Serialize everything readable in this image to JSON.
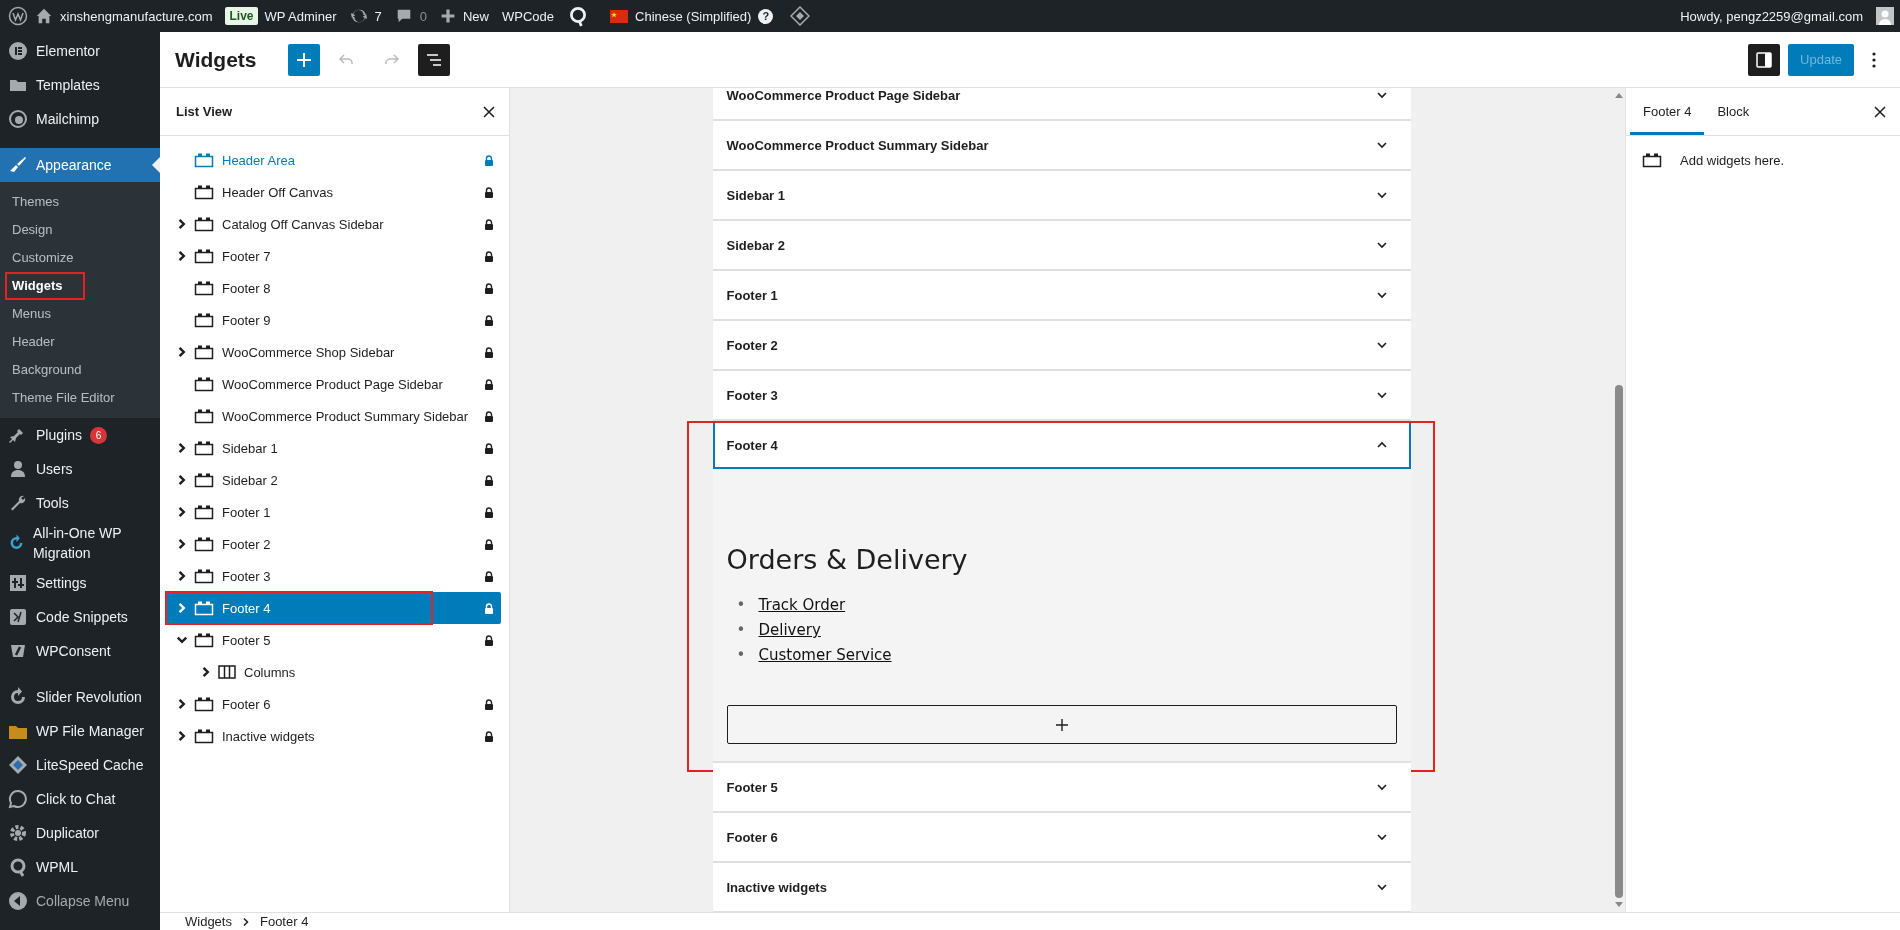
{
  "admin_bar": {
    "site_name": "xinshengmanufacture.com",
    "environment_badge": "Live",
    "tools": "WP Adminer",
    "updates": "7",
    "comments": "0",
    "new": "New",
    "wpcode": "WPCode",
    "language": "Chinese (Simplified)",
    "language_help": "?",
    "greeting": "Howdy, pengz2259@gmail.com"
  },
  "admin_menu": {
    "items": [
      {
        "kind": "item",
        "label": "Elementor",
        "selected": false
      },
      {
        "kind": "item",
        "label": "Templates",
        "selected": false
      },
      {
        "kind": "item",
        "label": "Mailchimp",
        "selected": false
      },
      {
        "kind": "separator"
      },
      {
        "kind": "item",
        "label": "Appearance",
        "selected": true,
        "children": [
          {
            "label": "Themes",
            "selected": false,
            "marked": false
          },
          {
            "label": "Design",
            "selected": false,
            "marked": false
          },
          {
            "label": "Customize",
            "selected": false,
            "marked": false
          },
          {
            "label": "Widgets",
            "selected": true,
            "marked": true
          },
          {
            "label": "Menus",
            "selected": false,
            "marked": false
          },
          {
            "label": "Header",
            "selected": false,
            "marked": false
          },
          {
            "label": "Background",
            "selected": false,
            "marked": false
          },
          {
            "label": "Theme File Editor",
            "selected": false,
            "marked": false
          }
        ]
      },
      {
        "kind": "item",
        "label": "Plugins",
        "selected": false,
        "badge": "6"
      },
      {
        "kind": "item",
        "label": "Users",
        "selected": false
      },
      {
        "kind": "item",
        "label": "Tools",
        "selected": false
      },
      {
        "kind": "item",
        "label": "All-in-One WP Migration",
        "selected": false
      },
      {
        "kind": "item",
        "label": "Settings",
        "selected": false
      },
      {
        "kind": "item",
        "label": "Code Snippets",
        "selected": false
      },
      {
        "kind": "item",
        "label": "WPConsent",
        "selected": false
      },
      {
        "kind": "separator"
      },
      {
        "kind": "item",
        "label": "Slider Revolution",
        "selected": false
      },
      {
        "kind": "item",
        "label": "WP File Manager",
        "selected": false
      },
      {
        "kind": "item",
        "label": "LiteSpeed Cache",
        "selected": false
      },
      {
        "kind": "item",
        "label": "Click to Chat",
        "selected": false
      },
      {
        "kind": "item",
        "label": "Duplicator",
        "selected": false
      },
      {
        "kind": "item",
        "label": "WPML",
        "selected": false
      }
    ],
    "collapse": "Collapse Menu"
  },
  "editor": {
    "title": "Widgets",
    "update_button": {
      "label": "Update",
      "disabled": true
    }
  },
  "list_view": {
    "title": "List View",
    "items": [
      {
        "label": "Header Area",
        "kind": "widget-area",
        "hovered": true,
        "selected": false,
        "expandable": false,
        "expanded": false,
        "locked": true,
        "marked": false
      },
      {
        "label": "Header Off Canvas",
        "kind": "widget-area",
        "hovered": false,
        "selected": false,
        "expandable": false,
        "expanded": false,
        "locked": true,
        "marked": false
      },
      {
        "label": "Catalog Off Canvas Sidebar",
        "kind": "widget-area",
        "hovered": false,
        "selected": false,
        "expandable": true,
        "expanded": false,
        "locked": true,
        "marked": false
      },
      {
        "label": "Footer 7",
        "kind": "widget-area",
        "hovered": false,
        "selected": false,
        "expandable": true,
        "expanded": false,
        "locked": true,
        "marked": false
      },
      {
        "label": "Footer 8",
        "kind": "widget-area",
        "hovered": false,
        "selected": false,
        "expandable": false,
        "expanded": false,
        "locked": true,
        "marked": false
      },
      {
        "label": "Footer 9",
        "kind": "widget-area",
        "hovered": false,
        "selected": false,
        "expandable": false,
        "expanded": false,
        "locked": true,
        "marked": false
      },
      {
        "label": "WooCommerce Shop Sidebar",
        "kind": "widget-area",
        "hovered": false,
        "selected": false,
        "expandable": true,
        "expanded": false,
        "locked": true,
        "marked": false
      },
      {
        "label": "WooCommerce Product Page Sidebar",
        "kind": "widget-area",
        "hovered": false,
        "selected": false,
        "expandable": false,
        "expanded": false,
        "locked": true,
        "marked": false
      },
      {
        "label": "WooCommerce Product Summary Sidebar",
        "kind": "widget-area",
        "hovered": false,
        "selected": false,
        "expandable": false,
        "expanded": false,
        "locked": true,
        "marked": false
      },
      {
        "label": "Sidebar 1",
        "kind": "widget-area",
        "hovered": false,
        "selected": false,
        "expandable": true,
        "expanded": false,
        "locked": true,
        "marked": false
      },
      {
        "label": "Sidebar 2",
        "kind": "widget-area",
        "hovered": false,
        "selected": false,
        "expandable": true,
        "expanded": false,
        "locked": true,
        "marked": false
      },
      {
        "label": "Footer 1",
        "kind": "widget-area",
        "hovered": false,
        "selected": false,
        "expandable": true,
        "expanded": false,
        "locked": true,
        "marked": false
      },
      {
        "label": "Footer 2",
        "kind": "widget-area",
        "hovered": false,
        "selected": false,
        "expandable": true,
        "expanded": false,
        "locked": true,
        "marked": false
      },
      {
        "label": "Footer 3",
        "kind": "widget-area",
        "hovered": false,
        "selected": false,
        "expandable": true,
        "expanded": false,
        "locked": true,
        "marked": false
      },
      {
        "label": "Footer 4",
        "kind": "widget-area",
        "hovered": false,
        "selected": true,
        "expandable": true,
        "expanded": false,
        "locked": true,
        "marked": true
      },
      {
        "label": "Footer 5",
        "kind": "widget-area",
        "hovered": false,
        "selected": false,
        "expandable": true,
        "expanded": true,
        "locked": true,
        "marked": false,
        "children": [
          {
            "label": "Columns",
            "kind": "block",
            "hovered": false,
            "selected": false,
            "expandable": true,
            "expanded": false,
            "locked": false,
            "marked": false
          }
        ]
      },
      {
        "label": "Footer 6",
        "kind": "widget-area",
        "hovered": false,
        "selected": false,
        "expandable": true,
        "expanded": false,
        "locked": true,
        "marked": false
      },
      {
        "label": "Inactive widgets",
        "kind": "widget-area",
        "hovered": false,
        "selected": false,
        "expandable": true,
        "expanded": false,
        "locked": true,
        "marked": false
      }
    ]
  },
  "canvas": {
    "areas": [
      {
        "title": "WooCommerce Product Page Sidebar",
        "expanded": false,
        "marked": false
      },
      {
        "title": "WooCommerce Product Summary Sidebar",
        "expanded": false,
        "marked": false
      },
      {
        "title": "Sidebar 1",
        "expanded": false,
        "marked": false
      },
      {
        "title": "Sidebar 2",
        "expanded": false,
        "marked": false
      },
      {
        "title": "Footer 1",
        "expanded": false,
        "marked": false
      },
      {
        "title": "Footer 2",
        "expanded": false,
        "marked": false
      },
      {
        "title": "Footer 3",
        "expanded": false,
        "marked": false
      },
      {
        "title": "Footer 4",
        "expanded": true,
        "marked": true,
        "heading": "Orders & Delivery",
        "links": [
          {
            "marker": "•",
            "label": "Track Order"
          },
          {
            "marker": "•",
            "label": "Delivery"
          },
          {
            "marker": "•",
            "label": "Customer Service"
          }
        ]
      },
      {
        "title": "Footer 5",
        "expanded": false,
        "marked": false
      },
      {
        "title": "Footer 6",
        "expanded": false,
        "marked": false
      },
      {
        "title": "Inactive widgets",
        "expanded": false,
        "marked": false
      }
    ]
  },
  "inspector": {
    "tabs": [
      {
        "label": "Footer 4",
        "selected": true
      },
      {
        "label": "Block",
        "selected": false
      }
    ],
    "message": "Add widgets here."
  },
  "breadcrumb": [
    "Widgets",
    "Footer 4"
  ]
}
